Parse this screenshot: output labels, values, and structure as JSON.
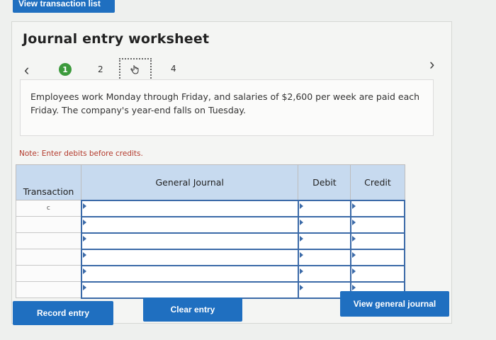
{
  "top_button": {
    "label": "View transaction list"
  },
  "worksheet": {
    "title": "Journal entry worksheet",
    "nav": {
      "prev_icon": "chevron-left-icon",
      "next_icon": "chevron-right-icon",
      "steps": [
        {
          "label": "1",
          "state": "done"
        },
        {
          "label": "2",
          "state": "default"
        },
        {
          "label": "",
          "state": "current",
          "icon": "pointing-hand-icon"
        },
        {
          "label": "4",
          "state": "default"
        }
      ]
    },
    "description": "Employees work Monday through Friday, and salaries of $2,600 per week are paid each Friday. The company's year-end falls on Tuesday.",
    "note": "Note: Enter debits before credits."
  },
  "table": {
    "headers": {
      "transaction": "Transaction",
      "general_journal": "General Journal",
      "debit": "Debit",
      "credit": "Credit"
    },
    "rows": [
      {
        "transaction": "c",
        "general_journal": "",
        "debit": "",
        "credit": ""
      },
      {
        "transaction": "",
        "general_journal": "",
        "debit": "",
        "credit": ""
      },
      {
        "transaction": "",
        "general_journal": "",
        "debit": "",
        "credit": ""
      },
      {
        "transaction": "",
        "general_journal": "",
        "debit": "",
        "credit": ""
      },
      {
        "transaction": "",
        "general_journal": "",
        "debit": "",
        "credit": ""
      },
      {
        "transaction": "",
        "general_journal": "",
        "debit": "",
        "credit": ""
      }
    ]
  },
  "buttons": {
    "record": "Record entry",
    "clear": "Clear entry",
    "view_journal": "View general journal"
  },
  "colors": {
    "accent": "#1f6fc0",
    "step_done": "#3c9a3c",
    "header_bg": "#c7daef",
    "note": "#b33a2c"
  }
}
